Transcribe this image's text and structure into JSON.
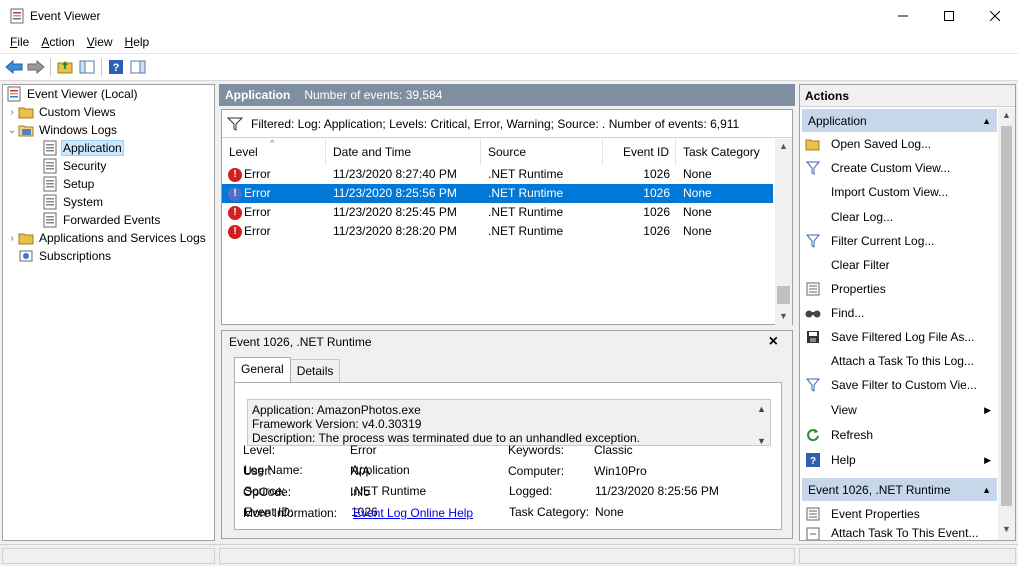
{
  "window": {
    "title": "Event Viewer",
    "controls": [
      "minimize",
      "maximize",
      "close"
    ]
  },
  "menu": [
    {
      "label": "File",
      "mnemonic": "F",
      "rest": "ile"
    },
    {
      "label": "Action",
      "mnemonic": "A",
      "rest": "ction"
    },
    {
      "label": "View",
      "mnemonic": "V",
      "rest": "iew"
    },
    {
      "label": "Help",
      "mnemonic": "H",
      "rest": "elp"
    }
  ],
  "toolbar": {
    "buttons": [
      "back-icon",
      "forward-icon",
      "up-folder-icon",
      "show-hide-tree-icon",
      "help-icon",
      "show-hide-action-pane-icon"
    ]
  },
  "tree": {
    "items": [
      {
        "label": "Event Viewer (Local)",
        "icon": "event-viewer-icon",
        "expander": ""
      },
      {
        "label": "Custom Views",
        "icon": "folder-icon",
        "expander": "›"
      },
      {
        "label": "Windows Logs",
        "icon": "folder-open-icon",
        "expander": "⌄"
      },
      {
        "label": "Application",
        "icon": "log-icon",
        "expander": ""
      },
      {
        "label": "Security",
        "icon": "log-icon",
        "expander": ""
      },
      {
        "label": "Setup",
        "icon": "log-icon",
        "expander": ""
      },
      {
        "label": "System",
        "icon": "log-icon",
        "expander": ""
      },
      {
        "label": "Forwarded Events",
        "icon": "log-icon",
        "expander": ""
      },
      {
        "label": "Applications and Services Logs",
        "icon": "folder-icon",
        "expander": "›"
      },
      {
        "label": "Subscriptions",
        "icon": "subscriptions-icon",
        "expander": ""
      }
    ]
  },
  "center": {
    "log_name": "Application",
    "event_count": "Number of events: 39,584",
    "filter_text": "Filtered: Log: Application; Levels: Critical, Error, Warning; Source: . Number of events: 6,911",
    "columns": [
      "Level",
      "Date and Time",
      "Source",
      "Event ID",
      "Task Category"
    ],
    "rows": [
      {
        "level": "Error",
        "datetime": "11/23/2020 8:27:40 PM",
        "source": ".NET Runtime",
        "event_id": "1026",
        "task": "None"
      },
      {
        "level": "Error",
        "datetime": "11/23/2020 8:25:56 PM",
        "source": ".NET Runtime",
        "event_id": "1026",
        "task": "None"
      },
      {
        "level": "Error",
        "datetime": "11/23/2020 8:25:45 PM",
        "source": ".NET Runtime",
        "event_id": "1026",
        "task": "None"
      },
      {
        "level": "Error",
        "datetime": "11/23/2020 8:28:20 PM",
        "source": ".NET Runtime",
        "event_id": "1026",
        "task": "None"
      }
    ],
    "selected_row": 1
  },
  "detail": {
    "title": "Event 1026, .NET Runtime",
    "tabs": [
      "General",
      "Details"
    ],
    "active_tab": "General",
    "description_lines": [
      "Application: AmazonPhotos.exe",
      "Framework Version: v4.0.30319",
      "Description: The process was terminated due to an unhandled exception."
    ],
    "fields": {
      "log_name": {
        "label": "Log Name:",
        "value": "Application"
      },
      "source": {
        "label": "Source:",
        "value": ".NET Runtime"
      },
      "event_id": {
        "label": "Event ID:",
        "value": "1026"
      },
      "level": {
        "label": "Level:",
        "value": "Error"
      },
      "user": {
        "label": "User:",
        "value": "N/A"
      },
      "opcode": {
        "label": "OpCode:",
        "value": "Info"
      },
      "more_info": {
        "label": "More Information:",
        "value": "Event Log Online Help"
      },
      "logged": {
        "label": "Logged:",
        "value": "11/23/2020 8:25:56 PM"
      },
      "task_category": {
        "label": "Task Category:",
        "value": "None"
      },
      "keywords": {
        "label": "Keywords:",
        "value": "Classic"
      },
      "computer": {
        "label": "Computer:",
        "value": "Win10Pro"
      }
    }
  },
  "actions": {
    "title": "Actions",
    "section1": "Application",
    "items1": [
      {
        "label": "Open Saved Log...",
        "icon": "open-log-icon"
      },
      {
        "label": "Create Custom View...",
        "icon": "filter-icon"
      },
      {
        "label": "Import Custom View...",
        "icon": ""
      },
      {
        "label": "Clear Log...",
        "icon": ""
      },
      {
        "label": "Filter Current Log...",
        "icon": "filter-icon"
      },
      {
        "label": "Clear Filter",
        "icon": ""
      },
      {
        "label": "Properties",
        "icon": "properties-icon"
      },
      {
        "label": "Find...",
        "icon": "find-icon"
      },
      {
        "label": "Save Filtered Log File As...",
        "icon": "save-icon"
      },
      {
        "label": "Attach a Task To this Log...",
        "icon": ""
      },
      {
        "label": "Save Filter to Custom Vie...",
        "icon": "filter-save-icon"
      },
      {
        "label": "View",
        "icon": "",
        "submenu": true
      },
      {
        "label": "Refresh",
        "icon": "refresh-icon"
      },
      {
        "label": "Help",
        "icon": "help-icon",
        "submenu": true
      }
    ],
    "section2": "Event 1026, .NET Runtime",
    "items2": [
      {
        "label": "Event Properties",
        "icon": "properties-icon"
      },
      {
        "label": "Attach Task To This Event...",
        "icon": "task-icon"
      }
    ]
  },
  "colors": {
    "header_bar": "#7f8ea0",
    "selection": "#0078d7",
    "section": "#c6d7ea",
    "error": "#d21e1e",
    "link": "#0000ee"
  }
}
